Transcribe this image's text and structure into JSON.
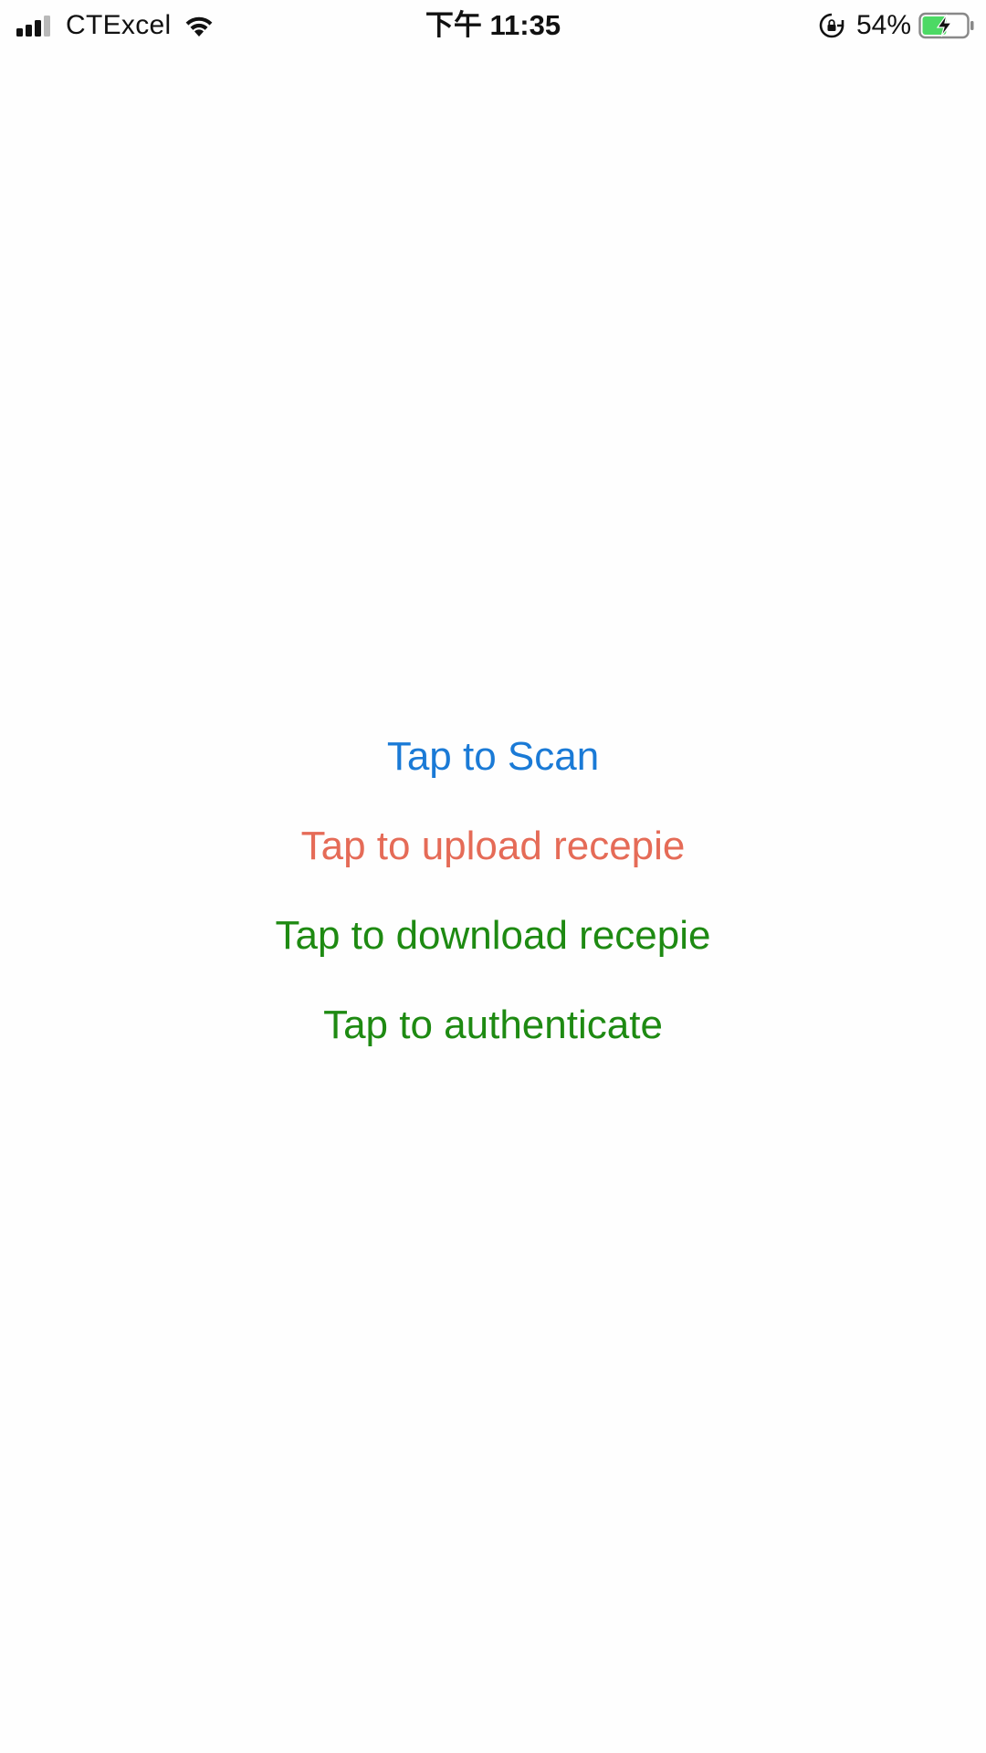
{
  "status_bar": {
    "carrier": "CTExcel",
    "time": "下午 11:35",
    "battery_percent": "54%",
    "battery_level": 0.54,
    "signal_bars_filled": 3,
    "signal_bars_total": 4,
    "icons": [
      "cellular-signal-icon",
      "wifi-icon",
      "rotation-lock-icon",
      "battery-charging-icon"
    ]
  },
  "menu": {
    "items": [
      {
        "label": "Tap to Scan",
        "color": "#1a7ad6"
      },
      {
        "label": "Tap to upload recepie",
        "color": "#e56b57"
      },
      {
        "label": "Tap to download recepie",
        "color": "#1e8a12"
      },
      {
        "label": "Tap to authenticate",
        "color": "#1e8a12"
      }
    ]
  },
  "colors": {
    "background": "#ffffff",
    "battery_fill": "#4cd964"
  }
}
